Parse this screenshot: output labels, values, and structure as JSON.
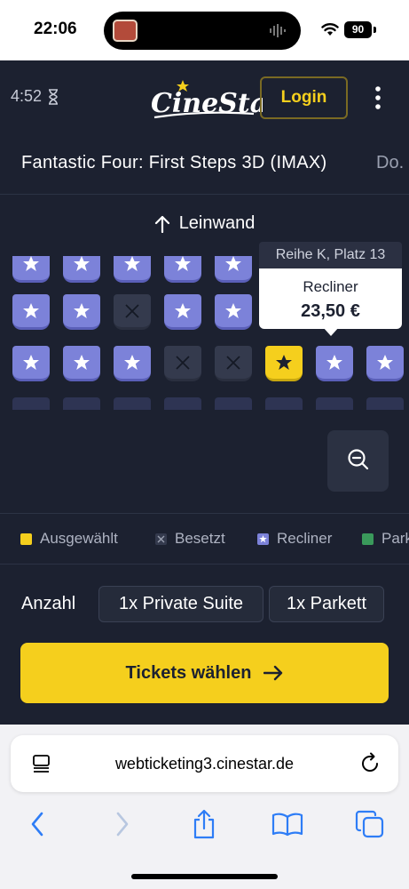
{
  "status_bar": {
    "time": "22:06",
    "battery": "90"
  },
  "header": {
    "timer": "4:52",
    "logo_text": "CineStar",
    "login_label": "Login"
  },
  "film": {
    "title": "Fantastic Four: First Steps 3D (IMAX)",
    "next_preview": "Do."
  },
  "screen": {
    "label": "Leinwand"
  },
  "seat_rows": [
    [
      "recliner",
      "recliner",
      "recliner",
      "recliner",
      "recliner",
      "recliner",
      "recliner",
      "recliner"
    ],
    [
      "recliner",
      "recliner",
      "taken",
      "recliner",
      "recliner",
      "recliner",
      "recliner",
      "recliner"
    ],
    [
      "recliner",
      "recliner",
      "recliner",
      "taken",
      "taken",
      "selected",
      "recliner",
      "recliner"
    ]
  ],
  "tooltip": {
    "header": "Reihe K, Platz 13",
    "category": "Recliner",
    "price": "23,50 €"
  },
  "legend": [
    {
      "label": "Ausgewählt",
      "color": "#f5cf1d"
    },
    {
      "label": "Besetzt",
      "color": "#343a4d"
    },
    {
      "label": "Recliner",
      "color": "#7c82d9"
    },
    {
      "label": "Parkett",
      "color": "#3a9a5b"
    }
  ],
  "quantity": {
    "label": "Anzahl",
    "chips": [
      "1x Private Suite",
      "1x Parkett"
    ]
  },
  "cta": {
    "label": "Tickets wählen"
  },
  "browser": {
    "url": "webticketing3.cinestar.de"
  },
  "colors": {
    "brand_yellow": "#f5cf1d",
    "background": "#1c2130",
    "recliner": "#7c82d9"
  }
}
